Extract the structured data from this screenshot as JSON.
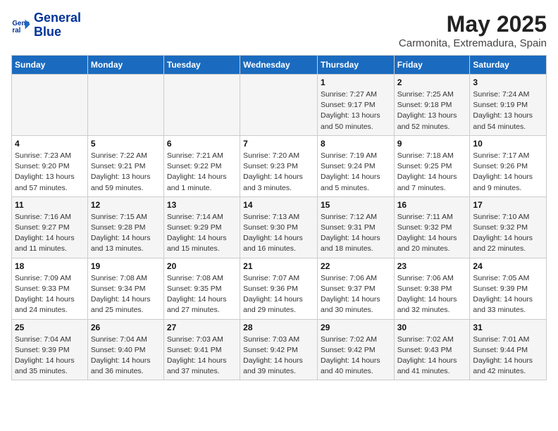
{
  "logo": {
    "line1": "General",
    "line2": "Blue"
  },
  "title": "May 2025",
  "subtitle": "Carmonita, Extremadura, Spain",
  "days_of_week": [
    "Sunday",
    "Monday",
    "Tuesday",
    "Wednesday",
    "Thursday",
    "Friday",
    "Saturday"
  ],
  "weeks": [
    [
      {
        "day": "",
        "info": ""
      },
      {
        "day": "",
        "info": ""
      },
      {
        "day": "",
        "info": ""
      },
      {
        "day": "",
        "info": ""
      },
      {
        "day": "1",
        "info": "Sunrise: 7:27 AM\nSunset: 9:17 PM\nDaylight: 13 hours\nand 50 minutes."
      },
      {
        "day": "2",
        "info": "Sunrise: 7:25 AM\nSunset: 9:18 PM\nDaylight: 13 hours\nand 52 minutes."
      },
      {
        "day": "3",
        "info": "Sunrise: 7:24 AM\nSunset: 9:19 PM\nDaylight: 13 hours\nand 54 minutes."
      }
    ],
    [
      {
        "day": "4",
        "info": "Sunrise: 7:23 AM\nSunset: 9:20 PM\nDaylight: 13 hours\nand 57 minutes."
      },
      {
        "day": "5",
        "info": "Sunrise: 7:22 AM\nSunset: 9:21 PM\nDaylight: 13 hours\nand 59 minutes."
      },
      {
        "day": "6",
        "info": "Sunrise: 7:21 AM\nSunset: 9:22 PM\nDaylight: 14 hours\nand 1 minute."
      },
      {
        "day": "7",
        "info": "Sunrise: 7:20 AM\nSunset: 9:23 PM\nDaylight: 14 hours\nand 3 minutes."
      },
      {
        "day": "8",
        "info": "Sunrise: 7:19 AM\nSunset: 9:24 PM\nDaylight: 14 hours\nand 5 minutes."
      },
      {
        "day": "9",
        "info": "Sunrise: 7:18 AM\nSunset: 9:25 PM\nDaylight: 14 hours\nand 7 minutes."
      },
      {
        "day": "10",
        "info": "Sunrise: 7:17 AM\nSunset: 9:26 PM\nDaylight: 14 hours\nand 9 minutes."
      }
    ],
    [
      {
        "day": "11",
        "info": "Sunrise: 7:16 AM\nSunset: 9:27 PM\nDaylight: 14 hours\nand 11 minutes."
      },
      {
        "day": "12",
        "info": "Sunrise: 7:15 AM\nSunset: 9:28 PM\nDaylight: 14 hours\nand 13 minutes."
      },
      {
        "day": "13",
        "info": "Sunrise: 7:14 AM\nSunset: 9:29 PM\nDaylight: 14 hours\nand 15 minutes."
      },
      {
        "day": "14",
        "info": "Sunrise: 7:13 AM\nSunset: 9:30 PM\nDaylight: 14 hours\nand 16 minutes."
      },
      {
        "day": "15",
        "info": "Sunrise: 7:12 AM\nSunset: 9:31 PM\nDaylight: 14 hours\nand 18 minutes."
      },
      {
        "day": "16",
        "info": "Sunrise: 7:11 AM\nSunset: 9:32 PM\nDaylight: 14 hours\nand 20 minutes."
      },
      {
        "day": "17",
        "info": "Sunrise: 7:10 AM\nSunset: 9:32 PM\nDaylight: 14 hours\nand 22 minutes."
      }
    ],
    [
      {
        "day": "18",
        "info": "Sunrise: 7:09 AM\nSunset: 9:33 PM\nDaylight: 14 hours\nand 24 minutes."
      },
      {
        "day": "19",
        "info": "Sunrise: 7:08 AM\nSunset: 9:34 PM\nDaylight: 14 hours\nand 25 minutes."
      },
      {
        "day": "20",
        "info": "Sunrise: 7:08 AM\nSunset: 9:35 PM\nDaylight: 14 hours\nand 27 minutes."
      },
      {
        "day": "21",
        "info": "Sunrise: 7:07 AM\nSunset: 9:36 PM\nDaylight: 14 hours\nand 29 minutes."
      },
      {
        "day": "22",
        "info": "Sunrise: 7:06 AM\nSunset: 9:37 PM\nDaylight: 14 hours\nand 30 minutes."
      },
      {
        "day": "23",
        "info": "Sunrise: 7:06 AM\nSunset: 9:38 PM\nDaylight: 14 hours\nand 32 minutes."
      },
      {
        "day": "24",
        "info": "Sunrise: 7:05 AM\nSunset: 9:39 PM\nDaylight: 14 hours\nand 33 minutes."
      }
    ],
    [
      {
        "day": "25",
        "info": "Sunrise: 7:04 AM\nSunset: 9:39 PM\nDaylight: 14 hours\nand 35 minutes."
      },
      {
        "day": "26",
        "info": "Sunrise: 7:04 AM\nSunset: 9:40 PM\nDaylight: 14 hours\nand 36 minutes."
      },
      {
        "day": "27",
        "info": "Sunrise: 7:03 AM\nSunset: 9:41 PM\nDaylight: 14 hours\nand 37 minutes."
      },
      {
        "day": "28",
        "info": "Sunrise: 7:03 AM\nSunset: 9:42 PM\nDaylight: 14 hours\nand 39 minutes."
      },
      {
        "day": "29",
        "info": "Sunrise: 7:02 AM\nSunset: 9:42 PM\nDaylight: 14 hours\nand 40 minutes."
      },
      {
        "day": "30",
        "info": "Sunrise: 7:02 AM\nSunset: 9:43 PM\nDaylight: 14 hours\nand 41 minutes."
      },
      {
        "day": "31",
        "info": "Sunrise: 7:01 AM\nSunset: 9:44 PM\nDaylight: 14 hours\nand 42 minutes."
      }
    ]
  ]
}
